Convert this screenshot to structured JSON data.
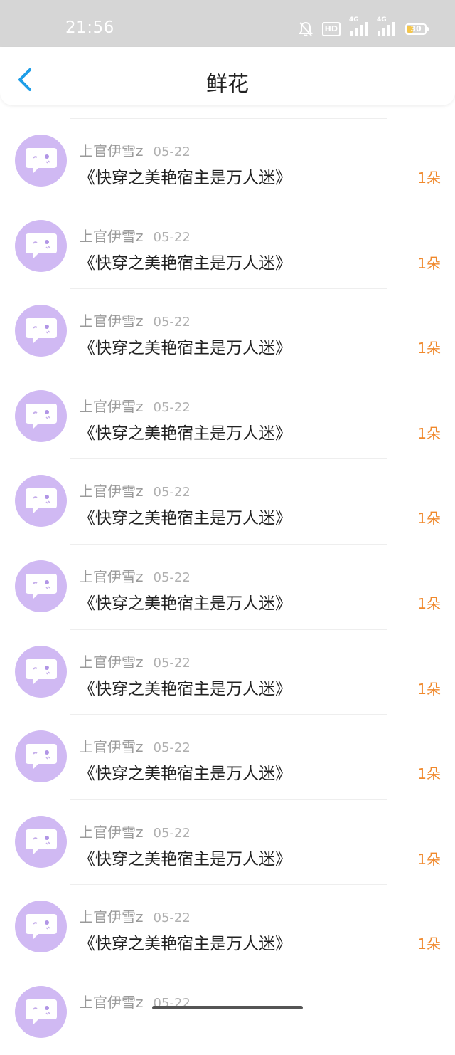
{
  "status_bar": {
    "time": "21:56",
    "network_label_1": "4G",
    "network_label_2": "4G",
    "hd_label": "HD",
    "battery_level": "30"
  },
  "header": {
    "title": "鲜花"
  },
  "colors": {
    "accent": "#1e9ee8",
    "count": "#f0892c",
    "avatar_bg": "#d0b9f3"
  },
  "items": [
    {
      "user": "上官伊雪z",
      "date": "05-22",
      "book": "《快穿之美艳宿主是万人迷》",
      "count": "1朵"
    },
    {
      "user": "上官伊雪z",
      "date": "05-22",
      "book": "《快穿之美艳宿主是万人迷》",
      "count": "1朵"
    },
    {
      "user": "上官伊雪z",
      "date": "05-22",
      "book": "《快穿之美艳宿主是万人迷》",
      "count": "1朵"
    },
    {
      "user": "上官伊雪z",
      "date": "05-22",
      "book": "《快穿之美艳宿主是万人迷》",
      "count": "1朵"
    },
    {
      "user": "上官伊雪z",
      "date": "05-22",
      "book": "《快穿之美艳宿主是万人迷》",
      "count": "1朵"
    },
    {
      "user": "上官伊雪z",
      "date": "05-22",
      "book": "《快穿之美艳宿主是万人迷》",
      "count": "1朵"
    },
    {
      "user": "上官伊雪z",
      "date": "05-22",
      "book": "《快穿之美艳宿主是万人迷》",
      "count": "1朵"
    },
    {
      "user": "上官伊雪z",
      "date": "05-22",
      "book": "《快穿之美艳宿主是万人迷》",
      "count": "1朵"
    },
    {
      "user": "上官伊雪z",
      "date": "05-22",
      "book": "《快穿之美艳宿主是万人迷》",
      "count": "1朵"
    },
    {
      "user": "上官伊雪z",
      "date": "05-22",
      "book": "《快穿之美艳宿主是万人迷》",
      "count": "1朵"
    },
    {
      "user": "上官伊雪z",
      "date": "05-22",
      "book": "",
      "count": ""
    }
  ]
}
